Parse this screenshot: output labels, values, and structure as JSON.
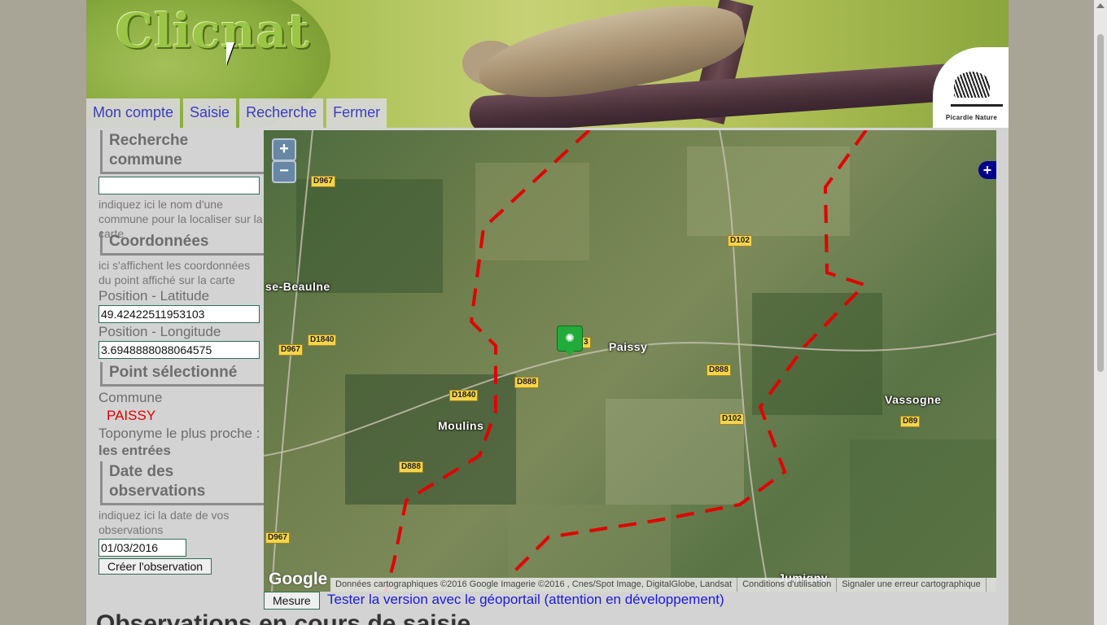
{
  "header": {
    "logo_text": "Clicnat",
    "org_name": "Picardie Nature"
  },
  "tabs": [
    {
      "label": "Mon compte"
    },
    {
      "label": "Saisie"
    },
    {
      "label": "Recherche"
    },
    {
      "label": "Fermer"
    }
  ],
  "sidebar": {
    "recherche": {
      "title": "Recherche commune",
      "input_value": "",
      "help": "indiquez ici le nom d'une commune pour la localiser sur la carte"
    },
    "coordonnees": {
      "title": "Coordonnées",
      "help": "ici s'affichent les coordonnées du point affiché sur la carte",
      "lat_label": "Position - Latitude",
      "lat_value": "49.42422511953103",
      "lon_label": "Position - Longitude",
      "lon_value": "3.6948888088064575"
    },
    "point": {
      "title": "Point sélectionné",
      "commune_label": "Commune",
      "commune_value": "PAISSY",
      "toponyme_label": "Toponyme le plus proche :",
      "toponyme_value": "les entrées"
    },
    "date": {
      "title": "Date des observations",
      "help": "indiquez ici la date de vos observations",
      "value": "01/03/2016",
      "create_button": "Créer l'observation"
    }
  },
  "map": {
    "zoom_in": "+",
    "zoom_out": "−",
    "layer_switcher": "+",
    "places": [
      {
        "name": "se-Beaulne"
      },
      {
        "name": "Paissy"
      },
      {
        "name": "Moulins"
      },
      {
        "name": "Vassogne"
      },
      {
        "name": "Jumigny"
      }
    ],
    "roads": [
      "D967",
      "D102",
      "D1840",
      "D967",
      "D888",
      "D1840",
      "D888",
      "D102",
      "D89",
      "D888",
      "D967",
      "D888",
      "3"
    ],
    "google_mark": "Google",
    "attribution": {
      "data": "Données cartographiques ©2016 Google Imagerie ©2016 , Cnes/Spot Image, DigitalGlobe, Landsat",
      "terms": "Conditions d'utilisation",
      "report": "Signaler une erreur cartographique"
    },
    "boundary_color": "#e00000",
    "marker_color": "#22aa3a"
  },
  "footer": {
    "mesure_button": "Mesure",
    "geoportail_link": "Tester la version avec le géoportail (attention en développement)",
    "observations_title": "Observations en cours de saisie"
  }
}
